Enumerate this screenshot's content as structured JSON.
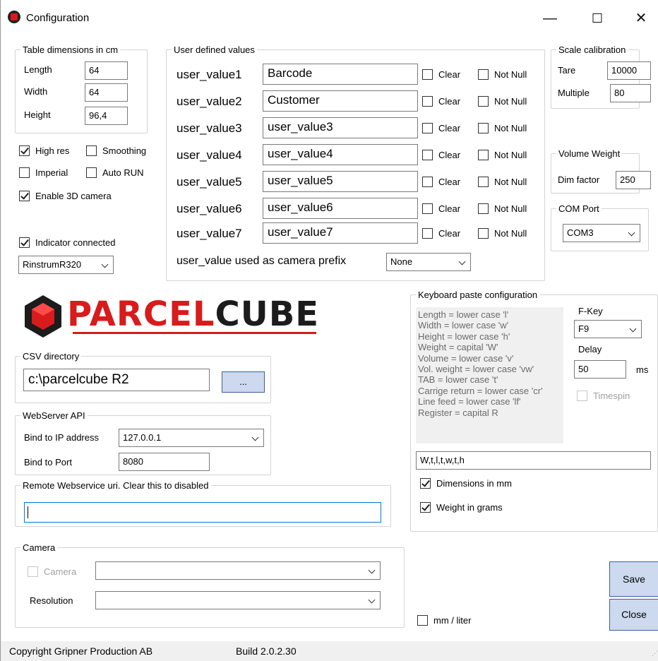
{
  "window": {
    "title": "Configuration",
    "min_label": "—",
    "max_label": "☐",
    "close_label": "✕"
  },
  "table_dims": {
    "legend": "Table dimensions in cm",
    "length_label": "Length",
    "length_value": "64",
    "width_label": "Width",
    "width_value": "64",
    "height_label": "Height",
    "height_value": "96,4"
  },
  "options": {
    "high_res": "High res",
    "smoothing": "Smoothing",
    "imperial": "Imperial",
    "auto_run": "Auto RUN",
    "enable_3d": "Enable 3D camera",
    "indicator": "Indicator connected",
    "indicator_model": "RinstrumR320"
  },
  "user_values": {
    "legend": "User defined values",
    "clear_label": "Clear",
    "not_null_label": "Not Null",
    "rows": [
      {
        "label": "user_value1",
        "value": "Barcode"
      },
      {
        "label": "user_value2",
        "value": "Customer"
      },
      {
        "label": "user_value3",
        "value": "user_value3"
      },
      {
        "label": "user_value4",
        "value": "user_value4"
      },
      {
        "label": "user_value5",
        "value": "user_value5"
      },
      {
        "label": "user_value6",
        "value": "user_value6"
      },
      {
        "label": "user_value7",
        "value": "user_value7"
      }
    ],
    "prefix_label": "user_value used as camera prefix",
    "prefix_value": "None"
  },
  "scale": {
    "legend": "Scale calibration",
    "tare_label": "Tare",
    "tare_value": "10000",
    "multiple_label": "Multiple",
    "multiple_value": "80"
  },
  "volume": {
    "legend": "Volume Weight",
    "dim_label": "Dim factor",
    "dim_value": "250"
  },
  "com": {
    "legend": "COM Port",
    "value": "COM3"
  },
  "logo": {
    "text": "PARCELCUBE",
    "brand_red": "#d81b1b"
  },
  "csv": {
    "legend": "CSV directory",
    "value": "c:\\parcelcube R2",
    "browse": "..."
  },
  "webserver": {
    "legend": "WebServer API",
    "ip_label": "Bind to IP address",
    "ip_value": "127.0.0.1",
    "port_label": "Bind to Port",
    "port_value": "8080"
  },
  "remote": {
    "legend": "Remote Webservice uri. Clear this to disabled",
    "value": ""
  },
  "camera": {
    "legend": "Camera",
    "camera_label": "Camera",
    "camera_value": "",
    "resolution_label": "Resolution",
    "resolution_value": ""
  },
  "keyboard": {
    "legend": "Keyboard paste configuration",
    "help": [
      "Length = lower case 'l'",
      "Width = lower case 'w'",
      "Height = lower case 'h'",
      "Weight = capital 'W'",
      "Volume = lower case 'v'",
      "Vol. weight = lower case 'vw'",
      "TAB = lower case 't'",
      "Carrige return = lower case 'cr'",
      "Line feed = lower case 'lf'",
      "Register = capital R"
    ],
    "fkey_label": "F-Key",
    "fkey_value": "F9",
    "delay_label": "Delay",
    "delay_value": "50",
    "delay_unit": "ms",
    "timespin": "Timespin",
    "pattern": "W,t,l,t,w,t,h",
    "dims_mm": "Dimensions in mm",
    "weight_grams": "Weight in grams"
  },
  "mm_liter": "mm / liter",
  "buttons": {
    "save": "Save",
    "close": "Close"
  },
  "status": {
    "copyright": "Copyright Gripner Production AB",
    "build": "Build 2.0.2.30"
  }
}
